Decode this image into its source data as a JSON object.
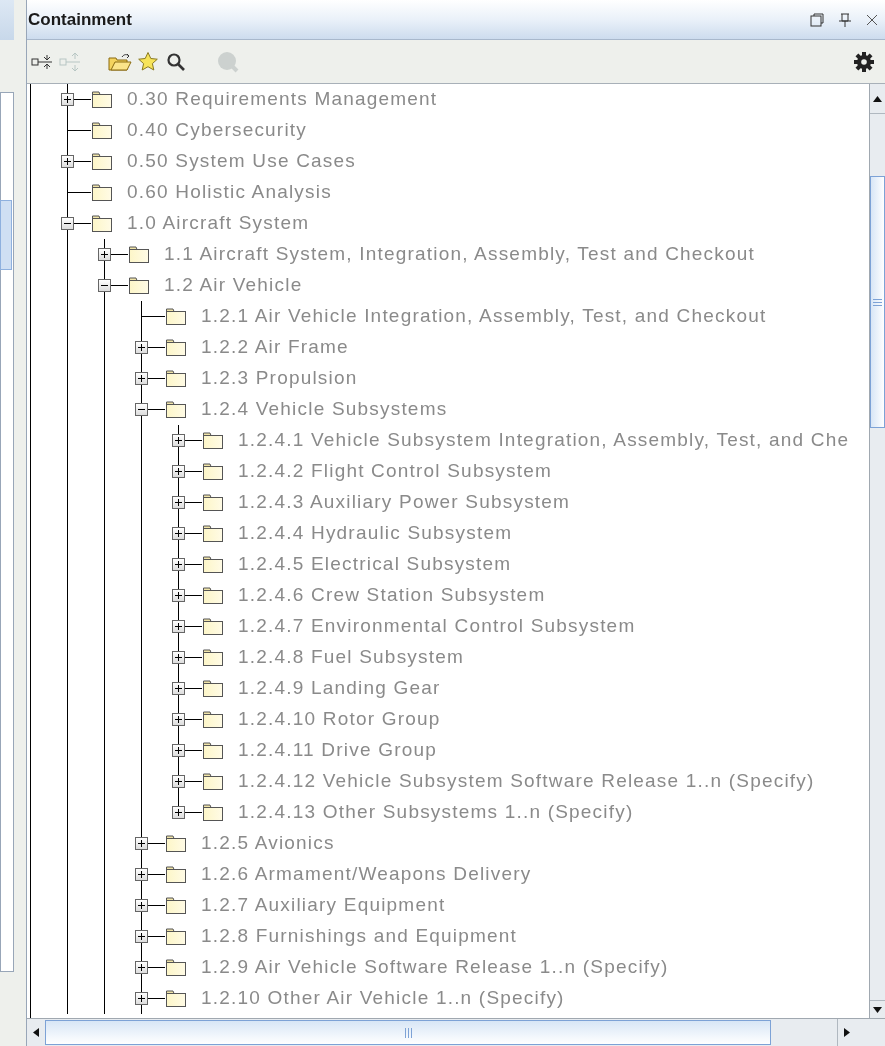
{
  "panel": {
    "title": "Containment"
  },
  "tree": [
    {
      "label": "0.30 Requirements Management",
      "expanded": false
    },
    {
      "label": "0.40 Cybersecurity"
    },
    {
      "label": "0.50 System Use Cases",
      "expanded": false
    },
    {
      "label": "0.60 Holistic Analysis"
    },
    {
      "label": "1.0 Aircraft System",
      "expanded": true,
      "children": [
        {
          "label": "1.1 Aircraft System, Integration, Assembly, Test and Checkout",
          "expanded": false
        },
        {
          "label": "1.2 Air Vehicle",
          "expanded": true,
          "children": [
            {
              "label": "1.2.1 Air Vehicle Integration, Assembly, Test, and Checkout"
            },
            {
              "label": "1.2.2 Air Frame",
              "expanded": false
            },
            {
              "label": "1.2.3 Propulsion",
              "expanded": false
            },
            {
              "label": "1.2.4 Vehicle Subsystems",
              "expanded": true,
              "children": [
                {
                  "label": "1.2.4.1 Vehicle Subsystem Integration, Assembly, Test, and Che",
                  "expanded": false
                },
                {
                  "label": "1.2.4.2 Flight Control Subsystem",
                  "expanded": false
                },
                {
                  "label": "1.2.4.3 Auxiliary Power Subsystem",
                  "expanded": false
                },
                {
                  "label": "1.2.4.4 Hydraulic Subsystem",
                  "expanded": false
                },
                {
                  "label": "1.2.4.5 Electrical Subsystem",
                  "expanded": false
                },
                {
                  "label": "1.2.4.6 Crew Station Subsystem",
                  "expanded": false
                },
                {
                  "label": "1.2.4.7 Environmental Control Subsystem",
                  "expanded": false
                },
                {
                  "label": "1.2.4.8 Fuel Subsystem",
                  "expanded": false
                },
                {
                  "label": "1.2.4.9 Landing Gear",
                  "expanded": false
                },
                {
                  "label": "1.2.4.10 Rotor Group",
                  "expanded": false
                },
                {
                  "label": "1.2.4.11 Drive Group",
                  "expanded": false
                },
                {
                  "label": "1.2.4.12 Vehicle Subsystem Software Release 1..n (Specify)",
                  "expanded": false
                },
                {
                  "label": "1.2.4.13 Other Subsystems 1..n (Specify)",
                  "expanded": false
                }
              ]
            },
            {
              "label": "1.2.5 Avionics",
              "expanded": false
            },
            {
              "label": "1.2.6 Armament/Weapons Delivery",
              "expanded": false
            },
            {
              "label": "1.2.7 Auxiliary Equipment",
              "expanded": false
            },
            {
              "label": "1.2.8 Furnishings and Equipment",
              "expanded": false
            },
            {
              "label": "1.2.9 Air Vehicle Software Release 1..n (Specify)",
              "expanded": false
            },
            {
              "label": "1.2.10 Other Air Vehicle 1..n (Specify)",
              "expanded": false
            }
          ]
        }
      ]
    }
  ]
}
